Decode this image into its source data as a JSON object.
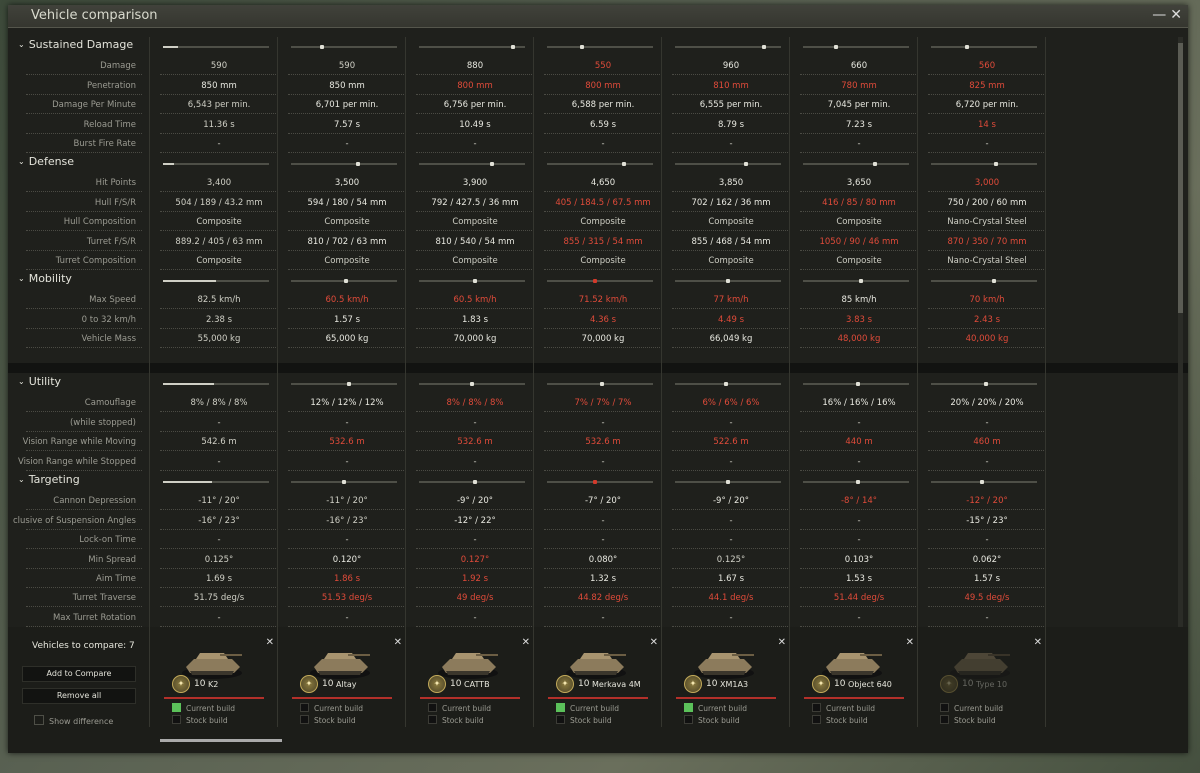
{
  "window": {
    "title": "Vehicle comparison",
    "minimize_glyph": "—",
    "close_glyph": "✕"
  },
  "sections": [
    {
      "id": "sustained",
      "label": "Sustained Damage",
      "bars": [
        0.14,
        0.28,
        0.9,
        0.32,
        0.85,
        0.3,
        0.33
      ],
      "rows": [
        {
          "label": "Damage",
          "values": [
            {
              "v": "590",
              "s": "dim"
            },
            {
              "v": "590",
              "s": "dim"
            },
            {
              "v": "880",
              "s": ""
            },
            {
              "v": "550",
              "s": "red"
            },
            {
              "v": "960",
              "s": ""
            },
            {
              "v": "660",
              "s": ""
            },
            {
              "v": "560",
              "s": "red"
            }
          ]
        },
        {
          "label": "Penetration",
          "values": [
            {
              "v": "850 mm",
              "s": ""
            },
            {
              "v": "850 mm",
              "s": ""
            },
            {
              "v": "800 mm",
              "s": "red"
            },
            {
              "v": "800 mm",
              "s": "red"
            },
            {
              "v": "810 mm",
              "s": "red"
            },
            {
              "v": "780 mm",
              "s": "red"
            },
            {
              "v": "825 mm",
              "s": "red"
            }
          ]
        },
        {
          "label": "Damage Per Minute",
          "values": [
            {
              "v": "6,543 per min.",
              "s": "dim"
            },
            {
              "v": "6,701 per min.",
              "s": ""
            },
            {
              "v": "6,756 per min.",
              "s": ""
            },
            {
              "v": "6,588 per min.",
              "s": ""
            },
            {
              "v": "6,555 per min.",
              "s": ""
            },
            {
              "v": "7,045 per min.",
              "s": ""
            },
            {
              "v": "6,720 per min.",
              "s": ""
            }
          ]
        },
        {
          "label": "Reload Time",
          "values": [
            {
              "v": "11.36 s",
              "s": "dim"
            },
            {
              "v": "7.57 s",
              "s": ""
            },
            {
              "v": "10.49 s",
              "s": ""
            },
            {
              "v": "6.59 s",
              "s": ""
            },
            {
              "v": "8.79 s",
              "s": ""
            },
            {
              "v": "7.23 s",
              "s": ""
            },
            {
              "v": "14 s",
              "s": "red"
            }
          ]
        },
        {
          "label": "Burst Fire Rate",
          "values": [
            {
              "v": "-",
              "s": "dim"
            },
            {
              "v": "-",
              "s": "dim"
            },
            {
              "v": "-",
              "s": "dim"
            },
            {
              "v": "-",
              "s": "dim"
            },
            {
              "v": "-",
              "s": "dim"
            },
            {
              "v": "-",
              "s": "dim"
            },
            {
              "v": "-",
              "s": "dim"
            }
          ]
        }
      ]
    },
    {
      "id": "defense",
      "label": "Defense",
      "bars": [
        0.1,
        0.64,
        0.7,
        0.74,
        0.68,
        0.69,
        0.62
      ],
      "rows": [
        {
          "label": "Hit Points",
          "values": [
            {
              "v": "3,400",
              "s": "dim"
            },
            {
              "v": "3,500",
              "s": ""
            },
            {
              "v": "3,900",
              "s": ""
            },
            {
              "v": "4,650",
              "s": ""
            },
            {
              "v": "3,850",
              "s": ""
            },
            {
              "v": "3,650",
              "s": ""
            },
            {
              "v": "3,000",
              "s": "red"
            }
          ]
        },
        {
          "label": "Hull F/S/R",
          "values": [
            {
              "v": "504 / 189 / 43.2 mm",
              "s": "dim"
            },
            {
              "v": "594 / 180 / 54 mm",
              "s": ""
            },
            {
              "v": "792 / 427.5 / 36 mm",
              "s": ""
            },
            {
              "v": "405 / 184.5 / 67.5 mm",
              "s": "red"
            },
            {
              "v": "702 / 162 / 36 mm",
              "s": ""
            },
            {
              "v": "416 / 85 / 80 mm",
              "s": "red"
            },
            {
              "v": "750 / 200 / 60 mm",
              "s": ""
            }
          ]
        },
        {
          "label": "Hull Composition",
          "values": [
            {
              "v": "Composite",
              "s": "dim"
            },
            {
              "v": "Composite",
              "s": "dim"
            },
            {
              "v": "Composite",
              "s": "dim"
            },
            {
              "v": "Composite",
              "s": "dim"
            },
            {
              "v": "Composite",
              "s": "dim"
            },
            {
              "v": "Composite",
              "s": "dim"
            },
            {
              "v": "Nano-Crystal Steel",
              "s": "dim"
            }
          ]
        },
        {
          "label": "Turret F/S/R",
          "values": [
            {
              "v": "889.2 / 405 / 63 mm",
              "s": "dim"
            },
            {
              "v": "810 / 702 / 63 mm",
              "s": ""
            },
            {
              "v": "810 / 540 / 54 mm",
              "s": ""
            },
            {
              "v": "855 / 315 / 54 mm",
              "s": "red"
            },
            {
              "v": "855 / 468 / 54 mm",
              "s": ""
            },
            {
              "v": "1050 / 90 / 46 mm",
              "s": "red"
            },
            {
              "v": "870 / 350 / 70 mm",
              "s": "red"
            }
          ]
        },
        {
          "label": "Turret Composition",
          "values": [
            {
              "v": "Composite",
              "s": "dim"
            },
            {
              "v": "Composite",
              "s": "dim"
            },
            {
              "v": "Composite",
              "s": "dim"
            },
            {
              "v": "Composite",
              "s": "dim"
            },
            {
              "v": "Composite",
              "s": "dim"
            },
            {
              "v": "Composite",
              "s": "dim"
            },
            {
              "v": "Nano-Crystal Steel",
              "s": "dim"
            }
          ]
        }
      ]
    },
    {
      "id": "mobility",
      "label": "Mobility",
      "bars": [
        0.5,
        0.52,
        0.53,
        0.45,
        0.5,
        0.55,
        0.6
      ],
      "rows": [
        {
          "label": "Max Speed",
          "values": [
            {
              "v": "82.5 km/h",
              "s": "dim"
            },
            {
              "v": "60.5 km/h",
              "s": "red"
            },
            {
              "v": "60.5 km/h",
              "s": "red"
            },
            {
              "v": "71.52 km/h",
              "s": "red"
            },
            {
              "v": "77 km/h",
              "s": "red"
            },
            {
              "v": "85 km/h",
              "s": ""
            },
            {
              "v": "70 km/h",
              "s": "red"
            }
          ]
        },
        {
          "label": "0 to 32 km/h",
          "values": [
            {
              "v": "2.38 s",
              "s": "dim"
            },
            {
              "v": "1.57 s",
              "s": ""
            },
            {
              "v": "1.83 s",
              "s": ""
            },
            {
              "v": "4.36 s",
              "s": "red"
            },
            {
              "v": "4.49 s",
              "s": "red"
            },
            {
              "v": "3.83 s",
              "s": "red"
            },
            {
              "v": "2.43 s",
              "s": "red"
            }
          ]
        },
        {
          "label": "Vehicle Mass",
          "values": [
            {
              "v": "55,000 kg",
              "s": "dim"
            },
            {
              "v": "65,000 kg",
              "s": ""
            },
            {
              "v": "70,000 kg",
              "s": ""
            },
            {
              "v": "70,000 kg",
              "s": ""
            },
            {
              "v": "66,049 kg",
              "s": ""
            },
            {
              "v": "48,000 kg",
              "s": "red"
            },
            {
              "v": "40,000 kg",
              "s": "red"
            }
          ]
        }
      ]
    },
    {
      "id": "utility",
      "label": "Utility",
      "bars": [
        0.48,
        0.55,
        0.5,
        0.52,
        0.48,
        0.52,
        0.52
      ],
      "rows": [
        {
          "label": "Camouflage",
          "values": [
            {
              "v": "8% / 8% / 8%",
              "s": "dim"
            },
            {
              "v": "12% / 12% / 12%",
              "s": ""
            },
            {
              "v": "8% / 8% / 8%",
              "s": "red"
            },
            {
              "v": "7% / 7% / 7%",
              "s": "red"
            },
            {
              "v": "6% / 6% / 6%",
              "s": "red"
            },
            {
              "v": "16% / 16% / 16%",
              "s": ""
            },
            {
              "v": "20% / 20% / 20%",
              "s": ""
            }
          ]
        },
        {
          "label": "(while stopped)",
          "values": [
            {
              "v": "-",
              "s": "dim"
            },
            {
              "v": "-",
              "s": "dim"
            },
            {
              "v": "-",
              "s": "dim"
            },
            {
              "v": "-",
              "s": "dim"
            },
            {
              "v": "-",
              "s": "dim"
            },
            {
              "v": "-",
              "s": "dim"
            },
            {
              "v": "-",
              "s": "dim"
            }
          ]
        },
        {
          "label": "Vision Range while Moving",
          "values": [
            {
              "v": "542.6 m",
              "s": "dim"
            },
            {
              "v": "532.6 m",
              "s": "red"
            },
            {
              "v": "532.6 m",
              "s": "red"
            },
            {
              "v": "532.6 m",
              "s": "red"
            },
            {
              "v": "522.6 m",
              "s": "red"
            },
            {
              "v": "440 m",
              "s": "red"
            },
            {
              "v": "460 m",
              "s": "red"
            }
          ]
        },
        {
          "label": "Vision Range while Stopped",
          "values": [
            {
              "v": "-",
              "s": "dim"
            },
            {
              "v": "-",
              "s": "dim"
            },
            {
              "v": "-",
              "s": "dim"
            },
            {
              "v": "-",
              "s": "dim"
            },
            {
              "v": "-",
              "s": "dim"
            },
            {
              "v": "-",
              "s": "dim"
            },
            {
              "v": "-",
              "s": "dim"
            }
          ]
        }
      ]
    },
    {
      "id": "targeting",
      "label": "Targeting",
      "bars": [
        0.46,
        0.5,
        0.53,
        0.45,
        0.5,
        0.52,
        0.48
      ],
      "rows": [
        {
          "label": "Cannon Depression",
          "values": [
            {
              "v": "-11° / 20°",
              "s": "dim"
            },
            {
              "v": "-11° / 20°",
              "s": "dim"
            },
            {
              "v": "-9° / 20°",
              "s": ""
            },
            {
              "v": "-7° / 20°",
              "s": ""
            },
            {
              "v": "-9° / 20°",
              "s": ""
            },
            {
              "v": "-8° / 14°",
              "s": "red"
            },
            {
              "v": "-12° / 20°",
              "s": "red"
            }
          ]
        },
        {
          "label": "clusive of Suspension Angles",
          "values": [
            {
              "v": "-16° / 23°",
              "s": "dim"
            },
            {
              "v": "-16° / 23°",
              "s": "dim"
            },
            {
              "v": "-12° / 22°",
              "s": ""
            },
            {
              "v": "-",
              "s": "dim"
            },
            {
              "v": "-",
              "s": "dim"
            },
            {
              "v": "-",
              "s": "dim"
            },
            {
              "v": "-15° / 23°",
              "s": ""
            }
          ]
        },
        {
          "label": "Lock-on Time",
          "values": [
            {
              "v": "-",
              "s": "dim"
            },
            {
              "v": "-",
              "s": "dim"
            },
            {
              "v": "-",
              "s": "dim"
            },
            {
              "v": "-",
              "s": "dim"
            },
            {
              "v": "-",
              "s": "dim"
            },
            {
              "v": "-",
              "s": "dim"
            },
            {
              "v": "-",
              "s": "dim"
            }
          ]
        },
        {
          "label": "Min Spread",
          "values": [
            {
              "v": "0.125°",
              "s": "dim"
            },
            {
              "v": "0.120°",
              "s": ""
            },
            {
              "v": "0.127°",
              "s": "red"
            },
            {
              "v": "0.080°",
              "s": ""
            },
            {
              "v": "0.125°",
              "s": "dim"
            },
            {
              "v": "0.103°",
              "s": ""
            },
            {
              "v": "0.062°",
              "s": ""
            }
          ]
        },
        {
          "label": "Aim Time",
          "values": [
            {
              "v": "1.69 s",
              "s": "dim"
            },
            {
              "v": "1.86 s",
              "s": "red"
            },
            {
              "v": "1.92 s",
              "s": "red"
            },
            {
              "v": "1.32 s",
              "s": ""
            },
            {
              "v": "1.67 s",
              "s": ""
            },
            {
              "v": "1.53 s",
              "s": ""
            },
            {
              "v": "1.57 s",
              "s": ""
            }
          ]
        },
        {
          "label": "Turret Traverse",
          "values": [
            {
              "v": "51.75 deg/s",
              "s": "dim"
            },
            {
              "v": "51.53 deg/s",
              "s": "red"
            },
            {
              "v": "49 deg/s",
              "s": "red"
            },
            {
              "v": "44.82 deg/s",
              "s": "red"
            },
            {
              "v": "44.1 deg/s",
              "s": "red"
            },
            {
              "v": "51.44 deg/s",
              "s": "red"
            },
            {
              "v": "49.5 deg/s",
              "s": "red"
            }
          ]
        },
        {
          "label": "Max Turret Rotation",
          "values": [
            {
              "v": "-",
              "s": "dim"
            },
            {
              "v": "-",
              "s": "dim"
            },
            {
              "v": "-",
              "s": "dim"
            },
            {
              "v": "-",
              "s": "dim"
            },
            {
              "v": "-",
              "s": "dim"
            },
            {
              "v": "-",
              "s": "dim"
            },
            {
              "v": "-",
              "s": "dim"
            }
          ]
        }
      ]
    }
  ],
  "sidebar": {
    "vehicles_to_compare": "Vehicles to compare: 7",
    "add_label": "Add to Compare",
    "remove_label": "Remove all",
    "show_difference_label": "Show difference"
  },
  "vehicles": [
    {
      "tier": "10",
      "name": "K2",
      "current_build": true,
      "stock_build": false,
      "close": "✕",
      "badge": "✦",
      "build_labels": [
        "Current build",
        "Stock build"
      ]
    },
    {
      "tier": "10",
      "name": "Altay",
      "current_build": false,
      "stock_build": false,
      "close": "✕",
      "badge": "✦",
      "build_labels": [
        "Current build",
        "Stock build"
      ]
    },
    {
      "tier": "10",
      "name": "CATTB",
      "current_build": false,
      "stock_build": false,
      "close": "✕",
      "badge": "✦",
      "build_labels": [
        "Current build",
        "Stock build"
      ]
    },
    {
      "tier": "10",
      "name": "Merkava 4M",
      "current_build": true,
      "stock_build": false,
      "close": "✕",
      "badge": "✦",
      "build_labels": [
        "Current build",
        "Stock build"
      ]
    },
    {
      "tier": "10",
      "name": "XM1A3",
      "current_build": true,
      "stock_build": false,
      "close": "✕",
      "badge": "✦",
      "build_labels": [
        "Current build",
        "Stock build"
      ]
    },
    {
      "tier": "10",
      "name": "Object 640",
      "current_build": false,
      "stock_build": false,
      "close": "✕",
      "badge": "✦",
      "build_labels": [
        "Current build",
        "Stock build"
      ]
    },
    {
      "tier": "10",
      "name": "Type 10",
      "current_build": false,
      "stock_build": false,
      "faded": true,
      "close": "✕",
      "badge": "✦",
      "build_labels": [
        "Current build",
        "Stock build"
      ]
    }
  ],
  "colors": {
    "red_value": "#e04b3a",
    "current_build_on": "#5bc15a",
    "rank_line": "#b3302a"
  }
}
